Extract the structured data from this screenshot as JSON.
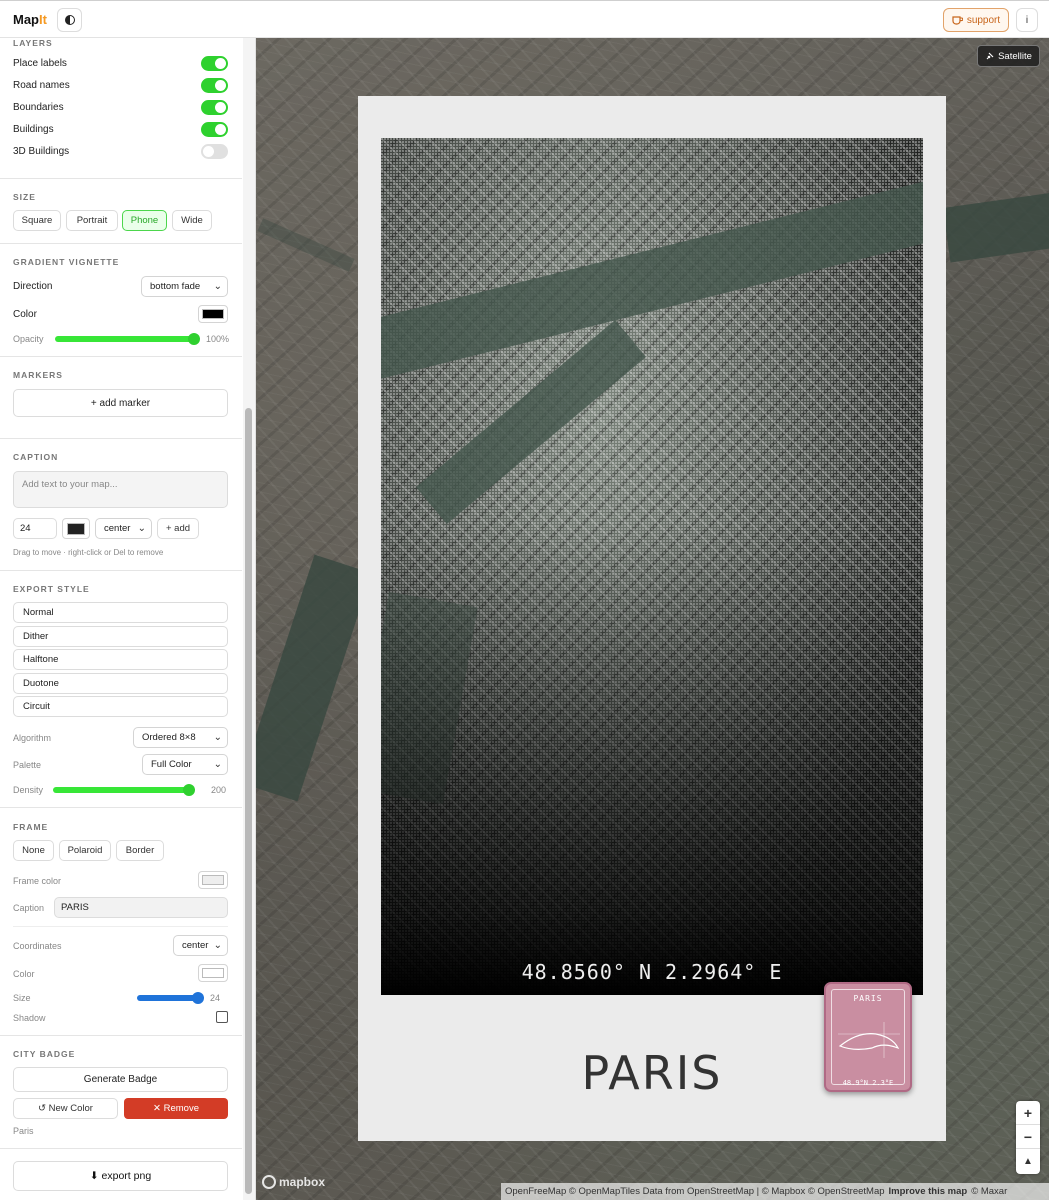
{
  "app": {
    "logo_main": "Map",
    "logo_accent": "It",
    "support_label": "support",
    "info_label": "i"
  },
  "sidebar": {
    "layers": {
      "title": "LAYERS",
      "items": [
        {
          "label": "Place labels",
          "on": true
        },
        {
          "label": "Road names",
          "on": true
        },
        {
          "label": "Boundaries",
          "on": true
        },
        {
          "label": "Buildings",
          "on": true
        },
        {
          "label": "3D Buildings",
          "on": false
        }
      ]
    },
    "size": {
      "title": "SIZE",
      "options": [
        "Square",
        "Portrait",
        "Phone",
        "Wide"
      ],
      "selected": "Phone"
    },
    "vignette": {
      "title": "GRADIENT VIGNETTE",
      "direction_label": "Direction",
      "direction_value": "bottom fade",
      "color_label": "Color",
      "color": "#000000",
      "opacity_label": "Opacity",
      "opacity_value": "100%",
      "opacity": 1.0
    },
    "markers": {
      "title": "MARKERS",
      "add_label": "+ add marker"
    },
    "caption": {
      "title": "CAPTION",
      "placeholder": "Add text to your map...",
      "font_size": "24",
      "color": "#222222",
      "align": "center",
      "add_label": "+ add",
      "hint": "Drag to move · right-click or Del to remove"
    },
    "export_style": {
      "title": "EXPORT STYLE",
      "options": [
        "Normal",
        "Dither",
        "Halftone",
        "Duotone",
        "Circuit"
      ],
      "algorithm_label": "Algorithm",
      "algorithm_value": "Ordered 8×8",
      "palette_label": "Palette",
      "palette_value": "Full Color",
      "density_label": "Density",
      "density_value": "200",
      "density": 1.0
    },
    "frame": {
      "title": "FRAME",
      "options": [
        "None",
        "Polaroid",
        "Border"
      ],
      "frame_color_label": "Frame color",
      "frame_color": "#eeeeee",
      "caption_label": "Caption",
      "caption_value": "PARIS",
      "coords_label": "Coordinates",
      "coords_value": "center",
      "color_label": "Color",
      "color": "#ffffff",
      "size_label": "Size",
      "size_value": "24",
      "size": 0.95,
      "shadow_label": "Shadow",
      "shadow": false
    },
    "city_badge": {
      "title": "CITY BADGE",
      "generate_label": "Generate Badge",
      "new_color_label": "↺ New Color",
      "remove_label": "✕ Remove",
      "city": "Paris"
    },
    "export_label": "⬇ export png"
  },
  "map": {
    "satellite_label": "Satellite",
    "poster_coords": "48.8560° N 2.2964° E",
    "poster_caption": "PARIS",
    "badge": {
      "title": "PARIS",
      "coords": "48.9°N 2.3°E",
      "color": "#c98ea1"
    },
    "zoom_in": "+",
    "zoom_out": "−",
    "compass": "▲",
    "mapbox_label": "mapbox",
    "attribution": "OpenFreeMap © OpenMapTiles Data from OpenStreetMap | © Mapbox © OpenStreetMap",
    "improve_label": "Improve this map",
    "attribution_end": "© Maxar"
  }
}
